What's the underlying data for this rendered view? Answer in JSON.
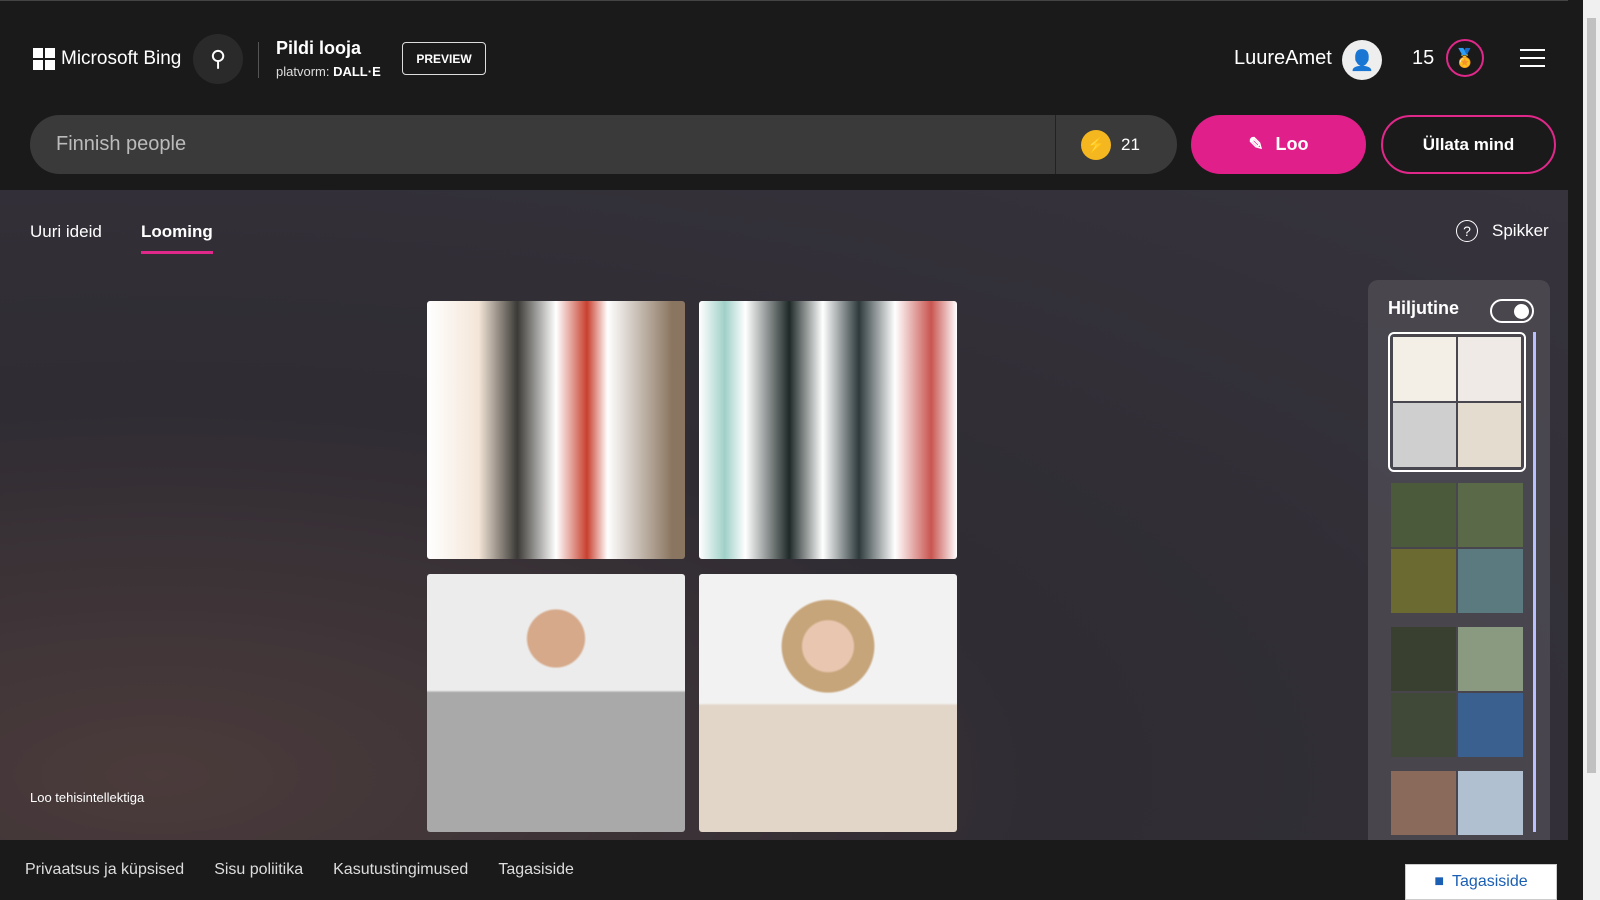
{
  "header": {
    "brand": "Microsoft Bing",
    "title": "Pildi looja",
    "platform_label": "platvorm:",
    "platform": "DALL·E",
    "preview": "PREVIEW",
    "username": "LuureAmet",
    "points": "15"
  },
  "search": {
    "value": "Finnish people",
    "boosts": "21",
    "create": "Loo",
    "surprise": "Üllata mind"
  },
  "tabs": [
    {
      "label": "Uuri ideid"
    },
    {
      "label": "Looming"
    }
  ],
  "help": "Spikker",
  "caption": "Loo tehisintellektiga",
  "panel": {
    "title": "Hiljutine"
  },
  "footer": {
    "links": [
      "Privaatsus ja küpsised",
      "Sisu poliitika",
      "Kasutustingimused",
      "Tagasiside"
    ],
    "feedback": "Tagasiside"
  },
  "colors": {
    "accent": "#e01f8a"
  }
}
